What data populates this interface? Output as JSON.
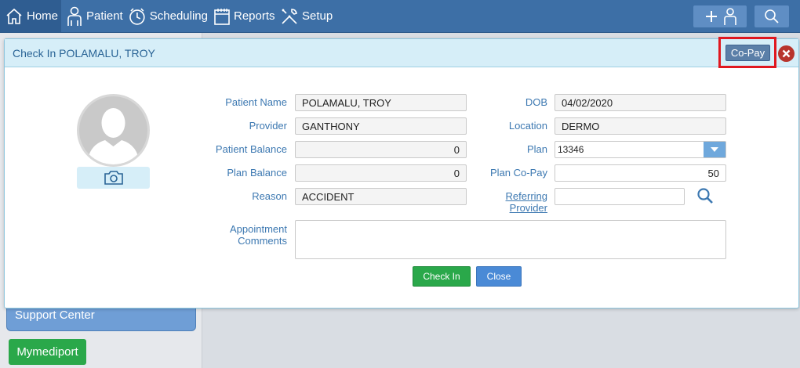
{
  "nav": {
    "home": "Home",
    "patient": "Patient",
    "scheduling": "Scheduling",
    "reports": "Reports",
    "setup": "Setup"
  },
  "sidebar": {
    "support_center": "Support Center",
    "mymediport": "Mymediport"
  },
  "modal": {
    "title": "Check In POLAMALU, TROY",
    "copay_button": "Co-Pay",
    "fields": {
      "patient_name_label": "Patient Name",
      "patient_name": "POLAMALU, TROY",
      "provider_label": "Provider",
      "provider": "GANTHONY",
      "patient_balance_label": "Patient Balance",
      "patient_balance": "0",
      "plan_balance_label": "Plan Balance",
      "plan_balance": "0",
      "reason_label": "Reason",
      "reason": "ACCIDENT",
      "dob_label": "DOB",
      "dob": "04/02/2020",
      "location_label": "Location",
      "location": "DERMO",
      "plan_label": "Plan",
      "plan": "13346",
      "plan_copay_label": "Plan Co-Pay",
      "plan_copay": "50",
      "referring_label_1": "Referring",
      "referring_label_2": "Provider",
      "referring_provider": "",
      "comments_label_1": "Appointment",
      "comments_label_2": "Comments",
      "comments": ""
    },
    "checkin_button": "Check In",
    "close_button": "Close"
  },
  "colors": {
    "topbar": "#3d6fa6",
    "accent_green": "#2aa84a",
    "accent_blue": "#4a8ad6",
    "label_blue": "#3c78b1",
    "highlight_red": "#e0171f"
  },
  "icons": [
    "home-icon",
    "patient-icon",
    "clock-icon",
    "calendar-icon",
    "tools-icon",
    "add-patient-icon",
    "search-icon",
    "close-icon",
    "camera-icon",
    "magnifier-icon",
    "dropdown-arrow-icon",
    "avatar-silhouette"
  ]
}
